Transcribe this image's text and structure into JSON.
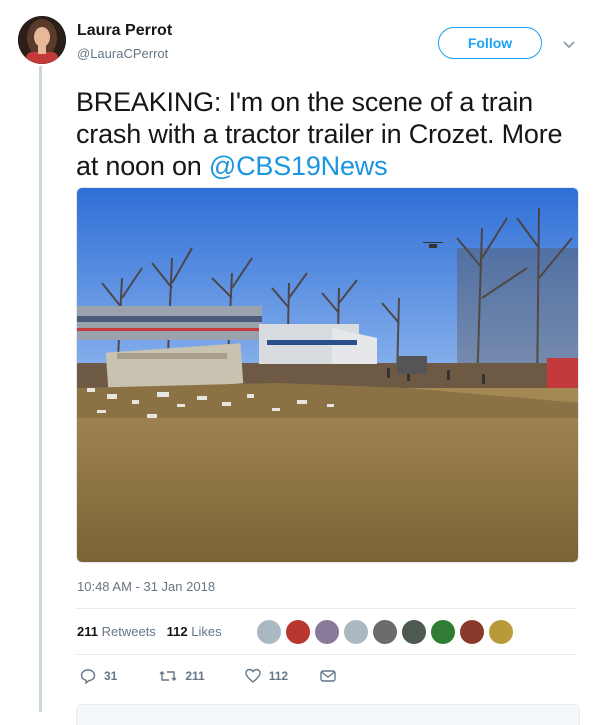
{
  "author": {
    "name": "Laura Perrot",
    "handle": "@LauraCPerrot"
  },
  "follow_label": "Follow",
  "tweet": {
    "text_before": "BREAKING: I'm on the scene of a train crash with a tractor trailer in Crozet. More at noon on ",
    "mention": "@CBS19News"
  },
  "timestamp": "10:48 AM - 31 Jan 2018",
  "stats": {
    "retweets_count": "211",
    "retweets_label": "Retweets",
    "likes_count": "112",
    "likes_label": "Likes"
  },
  "actions": {
    "reply_count": "31",
    "retweet_count": "211",
    "like_count": "112"
  },
  "colors": {
    "accent": "#1da1f2",
    "mention": "#1b95e0",
    "muted": "#657786"
  },
  "icons": [
    "chevron-down-icon",
    "reply-icon",
    "retweet-icon",
    "like-icon",
    "message-icon"
  ]
}
